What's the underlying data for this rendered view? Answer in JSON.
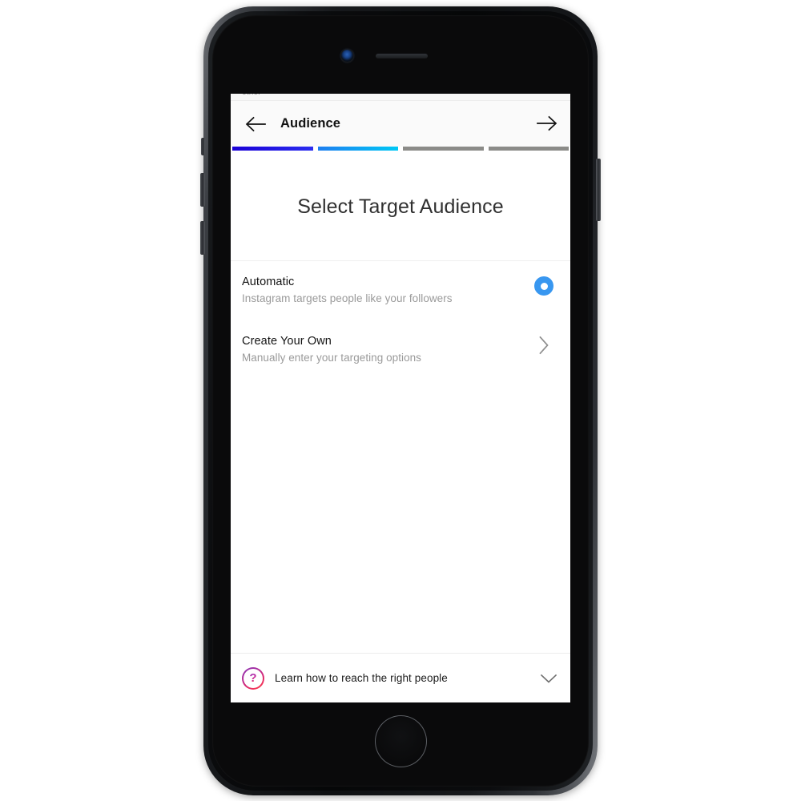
{
  "device": {
    "name": "iphone-black",
    "camera_icon": "front-camera",
    "speaker_icon": "earpiece-speaker",
    "home_button_icon": "home-button"
  },
  "clipped_top_text": "other",
  "navbar": {
    "back_icon": "arrow-left-icon",
    "title": "Audience",
    "next_icon": "arrow-right-icon"
  },
  "progress": {
    "segments": [
      {
        "name": "step-1",
        "state": "complete",
        "color_start": "#1a00d6",
        "color_end": "#2a2df0"
      },
      {
        "name": "step-2",
        "state": "current",
        "color_start": "#1e7ef0",
        "color_end": "#00c8f5"
      },
      {
        "name": "step-3",
        "state": "pending",
        "color_start": "#8b8b88",
        "color_end": "#8b8b88"
      },
      {
        "name": "step-4",
        "state": "pending",
        "color_start": "#8b8b88",
        "color_end": "#8b8b88"
      }
    ]
  },
  "hero": {
    "title": "Select Target Audience"
  },
  "options": [
    {
      "id": "automatic",
      "title": "Automatic",
      "subtitle": "Instagram targets people like your followers",
      "control": "radio-selected",
      "selected": true
    },
    {
      "id": "create-your-own",
      "title": "Create Your Own",
      "subtitle": "Manually enter your targeting options",
      "control": "chevron-right",
      "selected": false
    }
  ],
  "footer": {
    "help_icon": "question-circle-icon",
    "help_glyph": "?",
    "label": "Learn how to reach the right people",
    "expand_icon": "chevron-down-icon"
  },
  "colors": {
    "accent_blue": "#3897f0",
    "text_primary": "#131313",
    "text_secondary": "#9a9a9a",
    "navbar_bg": "#fafafa",
    "divider": "#efefef"
  }
}
